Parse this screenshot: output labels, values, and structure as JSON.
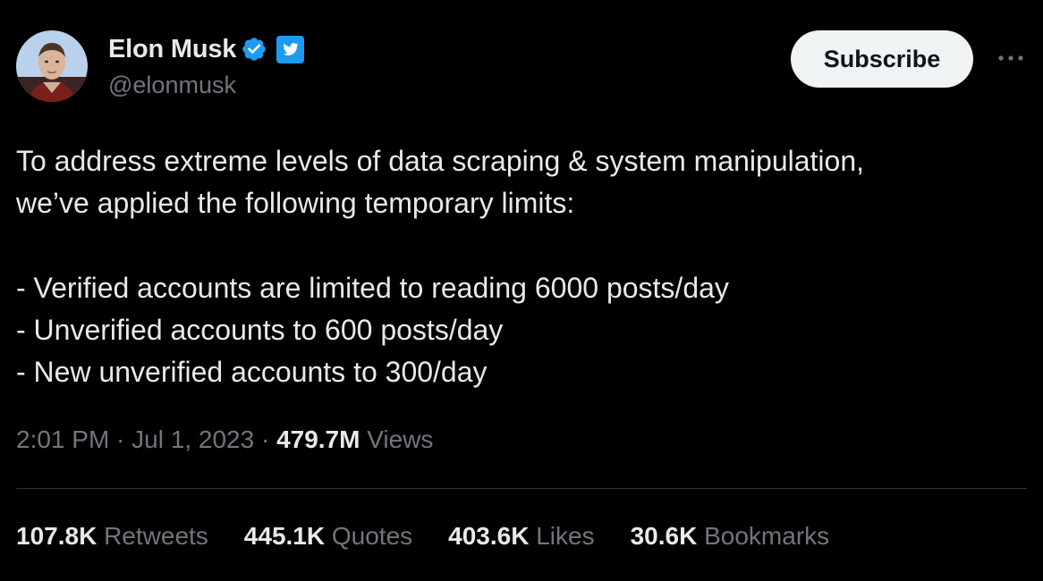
{
  "author": {
    "display_name": "Elon Musk",
    "handle": "@elonmusk",
    "verified_color": "#1d9bf0",
    "icons": [
      "verified-check-icon",
      "twitter-bird-badge-icon"
    ]
  },
  "actions": {
    "subscribe_label": "Subscribe",
    "more_icon": "more-dots-icon"
  },
  "tweet": {
    "lines": [
      "To address extreme levels of data scraping & system manipulation,",
      "we’ve applied the following temporary limits:"
    ],
    "list": [
      "- Verified accounts are limited to reading 6000 posts/day",
      "- Unverified accounts to 600 posts/day",
      "- New unverified accounts to 300/day"
    ]
  },
  "meta": {
    "time": "2:01 PM",
    "sep1": " · ",
    "date": "Jul 1, 2023",
    "sep2": " · ",
    "views_count": "479.7M",
    "views_label": " Views"
  },
  "stats": [
    {
      "count": "107.8K",
      "label": " Retweets"
    },
    {
      "count": "445.1K",
      "label": " Quotes"
    },
    {
      "count": "403.6K",
      "label": " Likes"
    },
    {
      "count": "30.6K",
      "label": " Bookmarks"
    }
  ],
  "colors": {
    "background": "#000000",
    "text_primary": "#e7e9ea",
    "text_secondary": "#71767b",
    "divider": "#2f3336",
    "button_bg": "#eff3f4"
  }
}
